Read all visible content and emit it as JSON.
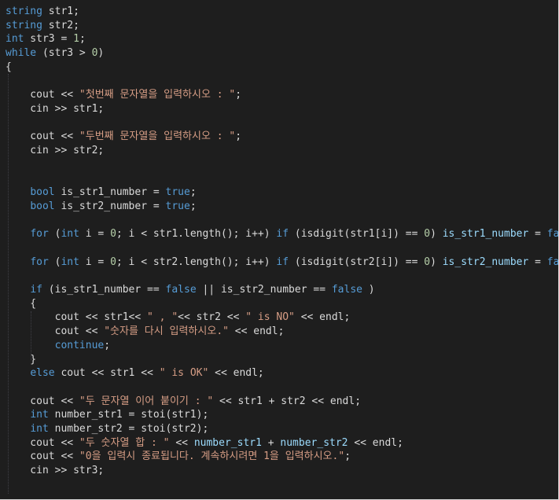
{
  "code": {
    "lines": [
      [
        {
          "t": "kw",
          "v": "string"
        },
        {
          "t": "id",
          "v": " str1;"
        }
      ],
      [
        {
          "t": "kw",
          "v": "string"
        },
        {
          "t": "id",
          "v": " str2;"
        }
      ],
      [
        {
          "t": "kw",
          "v": "int"
        },
        {
          "t": "id",
          "v": " str3 = "
        },
        {
          "t": "num",
          "v": "1"
        },
        {
          "t": "id",
          "v": ";"
        }
      ],
      [
        {
          "t": "kw",
          "v": "while"
        },
        {
          "t": "id",
          "v": " (str3 > "
        },
        {
          "t": "num",
          "v": "0"
        },
        {
          "t": "id",
          "v": ")"
        }
      ],
      [
        {
          "t": "id",
          "v": "{"
        }
      ],
      [],
      [
        {
          "t": "id",
          "v": "    cout << "
        },
        {
          "t": "str",
          "v": "\"첫번째 문자열을 입력하시오 : \""
        },
        {
          "t": "id",
          "v": ";"
        }
      ],
      [
        {
          "t": "id",
          "v": "    cin >> str1;"
        }
      ],
      [],
      [
        {
          "t": "id",
          "v": "    cout << "
        },
        {
          "t": "str",
          "v": "\"두번째 문자열을 입력하시오 : \""
        },
        {
          "t": "id",
          "v": ";"
        }
      ],
      [
        {
          "t": "id",
          "v": "    cin >> str2;"
        }
      ],
      [],
      [],
      [
        {
          "t": "id",
          "v": "    "
        },
        {
          "t": "kw",
          "v": "bool"
        },
        {
          "t": "id",
          "v": " is_str1_number = "
        },
        {
          "t": "kw",
          "v": "true"
        },
        {
          "t": "id",
          "v": ";"
        }
      ],
      [
        {
          "t": "id",
          "v": "    "
        },
        {
          "t": "kw",
          "v": "bool"
        },
        {
          "t": "id",
          "v": " is_str2_number = "
        },
        {
          "t": "kw",
          "v": "true"
        },
        {
          "t": "id",
          "v": ";"
        }
      ],
      [],
      [
        {
          "t": "id",
          "v": "    "
        },
        {
          "t": "kw",
          "v": "for"
        },
        {
          "t": "id",
          "v": " ("
        },
        {
          "t": "kw",
          "v": "int"
        },
        {
          "t": "id",
          "v": " i = "
        },
        {
          "t": "num",
          "v": "0"
        },
        {
          "t": "id",
          "v": "; i < str1.length(); i++) "
        },
        {
          "t": "kw",
          "v": "if"
        },
        {
          "t": "id",
          "v": " (isdigit(str1[i]) == "
        },
        {
          "t": "num",
          "v": "0"
        },
        {
          "t": "id",
          "v": ") "
        },
        {
          "t": "var",
          "v": "is_str1_number"
        },
        {
          "t": "id",
          "v": " = "
        },
        {
          "t": "kw",
          "v": "false"
        },
        {
          "t": "id",
          "v": ";"
        }
      ],
      [],
      [
        {
          "t": "id",
          "v": "    "
        },
        {
          "t": "kw",
          "v": "for"
        },
        {
          "t": "id",
          "v": " ("
        },
        {
          "t": "kw",
          "v": "int"
        },
        {
          "t": "id",
          "v": " i = "
        },
        {
          "t": "num",
          "v": "0"
        },
        {
          "t": "id",
          "v": "; i < str2.length(); i++) "
        },
        {
          "t": "kw",
          "v": "if"
        },
        {
          "t": "id",
          "v": " (isdigit(str2[i]) == "
        },
        {
          "t": "num",
          "v": "0"
        },
        {
          "t": "id",
          "v": ") "
        },
        {
          "t": "var",
          "v": "is_str2_number"
        },
        {
          "t": "id",
          "v": " = "
        },
        {
          "t": "kw",
          "v": "false"
        },
        {
          "t": "id",
          "v": ";"
        }
      ],
      [],
      [
        {
          "t": "id",
          "v": "    "
        },
        {
          "t": "kw",
          "v": "if"
        },
        {
          "t": "id",
          "v": " (is_str1_number == "
        },
        {
          "t": "kw",
          "v": "false"
        },
        {
          "t": "id",
          "v": " || is_str2_number == "
        },
        {
          "t": "kw",
          "v": "false"
        },
        {
          "t": "id",
          "v": " )"
        }
      ],
      [
        {
          "t": "id",
          "v": "    {"
        }
      ],
      [
        {
          "t": "id",
          "v": "        cout << str1<< "
        },
        {
          "t": "str",
          "v": "\" , \""
        },
        {
          "t": "id",
          "v": "<< str2 << "
        },
        {
          "t": "str",
          "v": "\" is NO\""
        },
        {
          "t": "id",
          "v": " << endl;"
        }
      ],
      [
        {
          "t": "id",
          "v": "        cout << "
        },
        {
          "t": "str",
          "v": "\"숫자를 다시 입력하시오.\""
        },
        {
          "t": "id",
          "v": " << endl;"
        }
      ],
      [
        {
          "t": "id",
          "v": "        "
        },
        {
          "t": "kw",
          "v": "continue"
        },
        {
          "t": "id",
          "v": ";"
        }
      ],
      [
        {
          "t": "id",
          "v": "    }"
        }
      ],
      [
        {
          "t": "id",
          "v": "    "
        },
        {
          "t": "kw",
          "v": "else"
        },
        {
          "t": "id",
          "v": " cout << str1 << "
        },
        {
          "t": "str",
          "v": "\" is OK\""
        },
        {
          "t": "id",
          "v": " << endl;"
        }
      ],
      [],
      [
        {
          "t": "id",
          "v": "    cout << "
        },
        {
          "t": "str",
          "v": "\"두 문자열 이어 붙이기 : \""
        },
        {
          "t": "id",
          "v": " << str1 + str2 << endl;"
        }
      ],
      [
        {
          "t": "id",
          "v": "    "
        },
        {
          "t": "kw",
          "v": "int"
        },
        {
          "t": "id",
          "v": " number_str1 = stoi(str1);"
        }
      ],
      [
        {
          "t": "id",
          "v": "    "
        },
        {
          "t": "kw",
          "v": "int"
        },
        {
          "t": "id",
          "v": " number_str2 = stoi(str2);"
        }
      ],
      [
        {
          "t": "id",
          "v": "    cout << "
        },
        {
          "t": "str",
          "v": "\"두 숫자열 합 : \""
        },
        {
          "t": "id",
          "v": " << "
        },
        {
          "t": "var",
          "v": "number_str1"
        },
        {
          "t": "id",
          "v": " + "
        },
        {
          "t": "var",
          "v": "number_str2"
        },
        {
          "t": "id",
          "v": " << endl;"
        }
      ],
      [
        {
          "t": "id",
          "v": "    cout << "
        },
        {
          "t": "str",
          "v": "\"0을 입력시 종료됩니다. 계속하시려면 1을 입력하시오.\""
        },
        {
          "t": "id",
          "v": ";"
        }
      ],
      [
        {
          "t": "id",
          "v": "    cin >> str3;"
        }
      ],
      [],
      [],
      [
        {
          "t": "id",
          "v": "}"
        }
      ]
    ]
  }
}
